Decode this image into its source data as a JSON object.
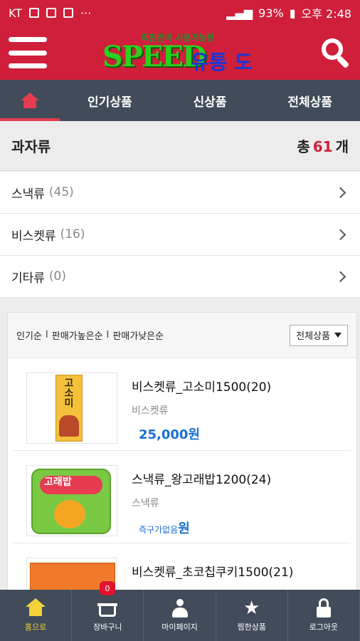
{
  "status_bar": {
    "carrier": "KT",
    "battery": "93%",
    "time": "오후 2:48",
    "dots": "···"
  },
  "header": {
    "logo_sub": "회원만이 사용가능한",
    "logo_main": "SPEED",
    "logo_tail": "유통 도매몰"
  },
  "nav": {
    "tabs": [
      {
        "label": "인기상품"
      },
      {
        "label": "신상품"
      },
      {
        "label": "전체상품"
      }
    ]
  },
  "category": {
    "title": "과자류",
    "total_prefix": "총",
    "total_count": "61",
    "total_suffix": "개",
    "subcategories": [
      {
        "label": "스낵류",
        "count": "(45)"
      },
      {
        "label": "비스켓류",
        "count": "(16)"
      },
      {
        "label": "기타류",
        "count": "(0)"
      }
    ]
  },
  "sort": {
    "options": [
      "인기순",
      "판매가높은순",
      "판매가낮은순"
    ],
    "separator": "I",
    "filter_selected": "전체상품"
  },
  "products": [
    {
      "name": "비스켓류_고소미1500(20)",
      "category": "비스켓류",
      "price": "25,000원",
      "thumb_text": "고소미"
    },
    {
      "name": "스낵류_왕고래밥1200(24)",
      "category": "스낵류",
      "price_note": "즉구가없음",
      "price_unit": "원",
      "thumb_text": "고래밥"
    },
    {
      "name": "비스켓류_초코칩쿠키1500(21)"
    }
  ],
  "bottom_nav": {
    "cart_badge": "0",
    "items": [
      {
        "label": "홈으로",
        "icon": "home-icon"
      },
      {
        "label": "장바구니",
        "icon": "cart-icon"
      },
      {
        "label": "마이페이지",
        "icon": "user-icon"
      },
      {
        "label": "찜한상품",
        "icon": "star-icon"
      },
      {
        "label": "로그아웃",
        "icon": "lock-icon"
      }
    ]
  },
  "colors": {
    "brand_red": "#cf1f3b",
    "nav_dark": "#414b5a",
    "price_blue": "#1a6fd0",
    "active_yellow": "#f4d33a"
  }
}
